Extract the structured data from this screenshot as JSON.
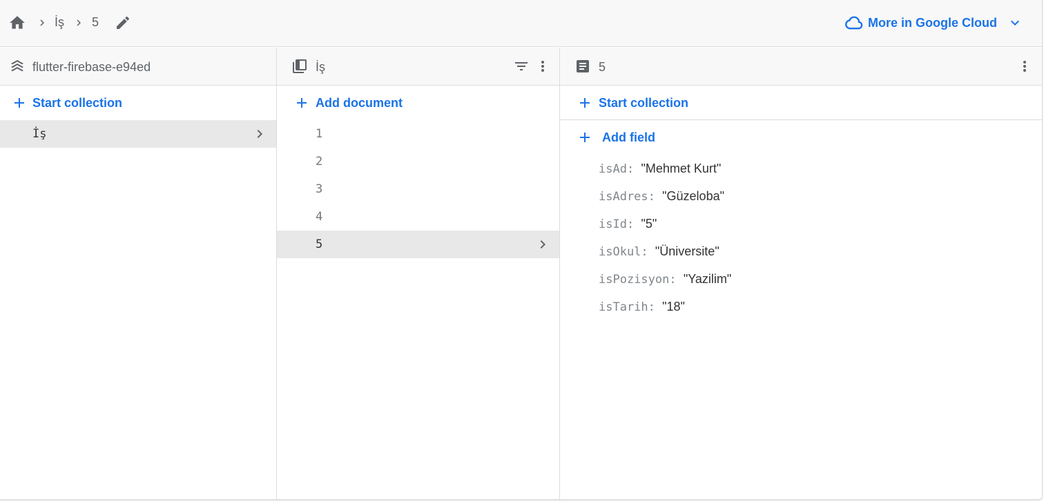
{
  "breadcrumb": {
    "items": [
      "İş",
      "5"
    ]
  },
  "cloud_link": {
    "label": "More in Google Cloud"
  },
  "panel_root": {
    "title": "flutter-firebase-e94ed",
    "action_label": "Start collection",
    "collections": [
      "İş"
    ],
    "selected": "İş"
  },
  "panel_collection": {
    "title": "İş",
    "action_label": "Add document",
    "documents": [
      "1",
      "2",
      "3",
      "4",
      "5"
    ],
    "selected": "5"
  },
  "panel_document": {
    "title": "5",
    "start_collection_label": "Start collection",
    "add_field_label": "Add field",
    "fields": [
      {
        "key": "isAd",
        "value": "\"Mehmet Kurt\""
      },
      {
        "key": "isAdres",
        "value": "\"Güzeloba\""
      },
      {
        "key": "isId",
        "value": "\"5\""
      },
      {
        "key": "isOkul",
        "value": "\"Üniversite\""
      },
      {
        "key": "isPozisyon",
        "value": "\"Yazilim\""
      },
      {
        "key": "isTarih",
        "value": "\"18\""
      }
    ]
  },
  "colors": {
    "accent": "#1a73e8",
    "icon_gray": "#5f6368",
    "selected_bg": "#e8e8e8",
    "header_bg": "#f8f8f8",
    "border": "#dadce0"
  }
}
